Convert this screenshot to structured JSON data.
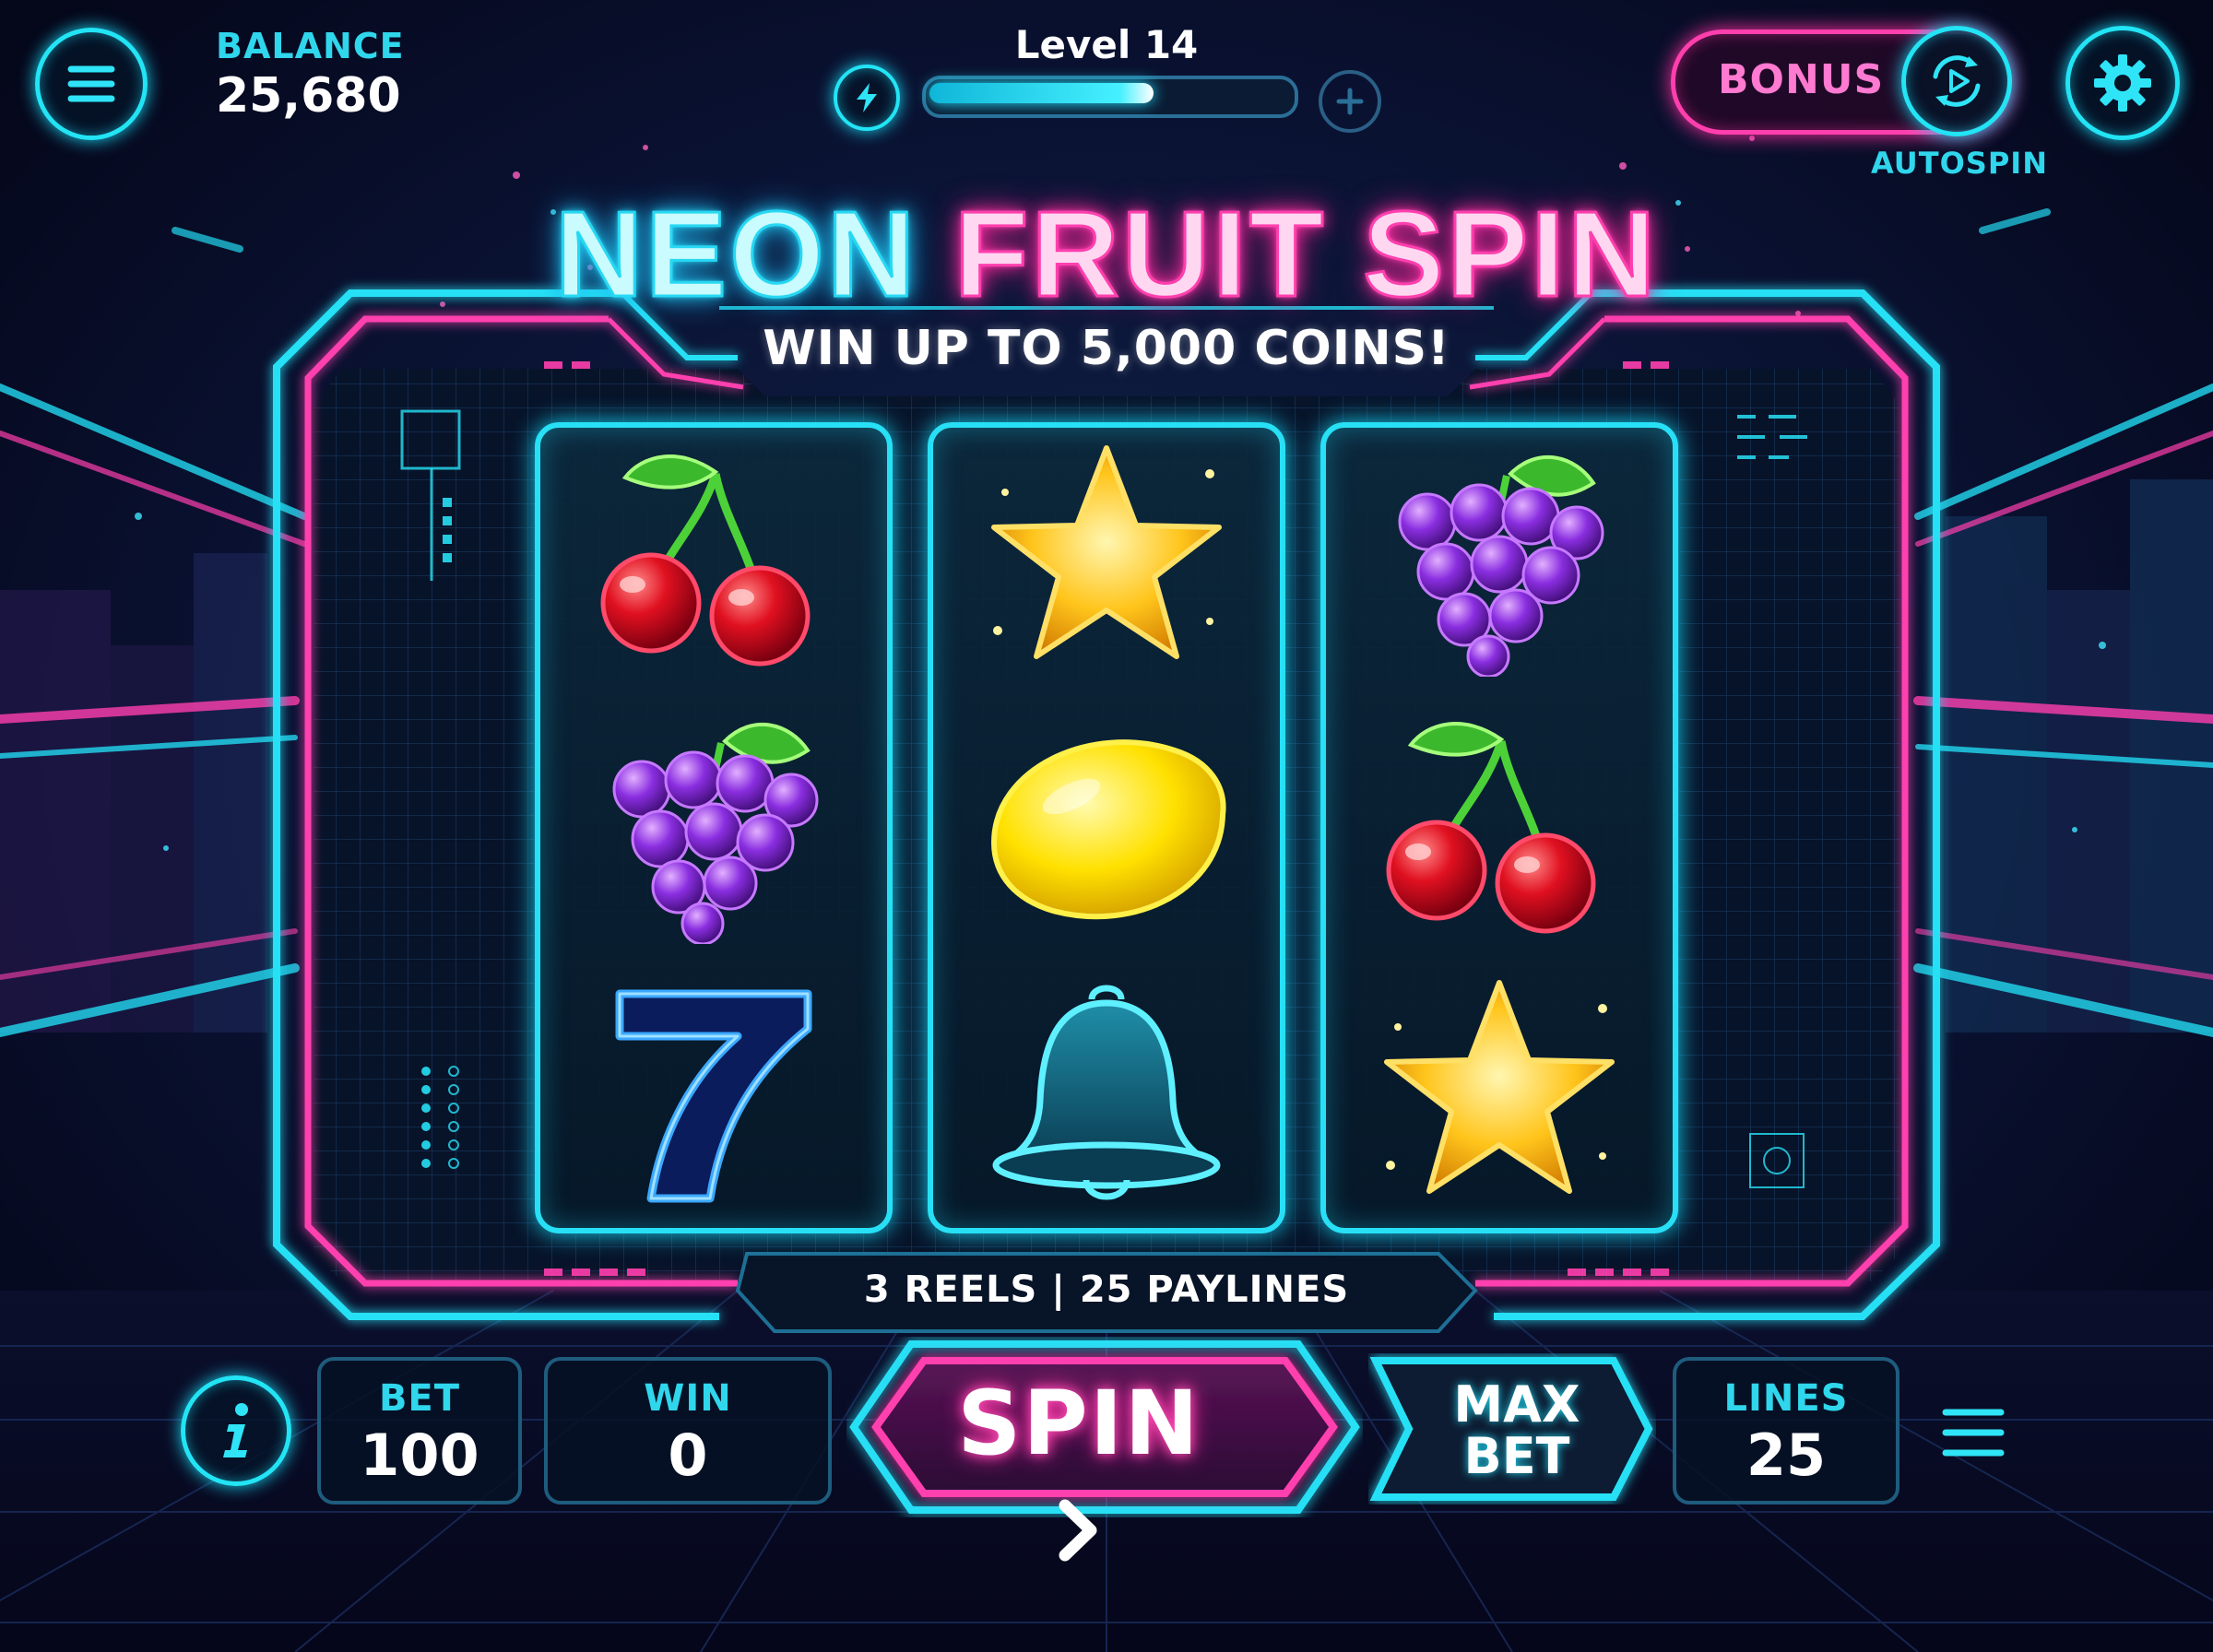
{
  "header": {
    "balance_label": "BALANCE",
    "balance_value": "25,680",
    "level_label": "Level 14",
    "level_progress": 0.62,
    "bonus_label": "BONUS",
    "autospin_label": "AUTOSPIN"
  },
  "title": {
    "part1": "NEON",
    "part2": "FRUIT SPIN",
    "subtitle": "WIN UP TO 5,000 COINS!"
  },
  "reels": [
    [
      "cherry",
      "grapes",
      "seven"
    ],
    [
      "star",
      "lemon",
      "bell"
    ],
    [
      "grapes",
      "cherry",
      "star"
    ]
  ],
  "info_strip": "3 REELS | 25 PAYLINES",
  "controls": {
    "bet_label": "BET",
    "bet_value": "100",
    "win_label": "WIN",
    "win_value": "0",
    "spin_label": "SPIN",
    "max_line1": "MAX",
    "max_line2": "BET",
    "lines_label": "LINES",
    "lines_value": "25"
  },
  "colors": {
    "neon_cyan": "#27e0f5",
    "neon_pink": "#ff3fae",
    "background": "#06081c"
  },
  "icons": {
    "menu": "hamburger-menu-icon",
    "settings": "gear-icon",
    "autospin": "autospin-icon",
    "xp": "lightning-icon",
    "add": "plus-icon",
    "info": "info-icon",
    "paytable": "list-icon"
  }
}
